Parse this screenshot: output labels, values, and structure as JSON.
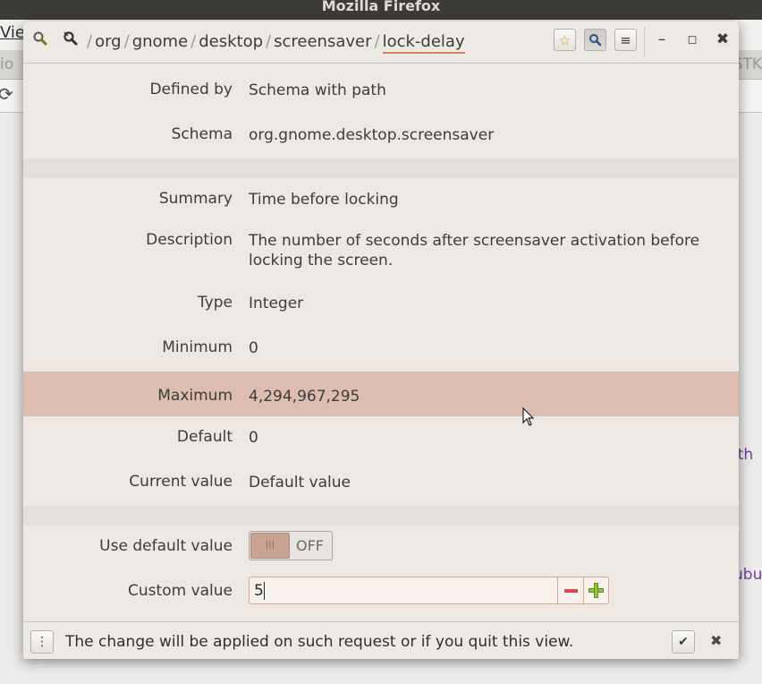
{
  "background_app": {
    "title": "Mozilla Firefox",
    "menu_view": "Vie",
    "tab_left": "io",
    "tab_right": "STK",
    "link_a": "ith",
    "link_b": "ubu"
  },
  "header": {
    "search_icon": "search-icon",
    "path_icon": "path-search-icon",
    "breadcrumbs": [
      "org",
      "gnome",
      "desktop",
      "screensaver",
      "lock-delay"
    ],
    "bookmark_icon": "star-icon",
    "search_toggle_icon": "magnifier-icon",
    "menu_icon": "hamburger-icon"
  },
  "properties": [
    {
      "label": "Defined by",
      "value": "Schema with path"
    },
    {
      "label": "Schema",
      "value": "org.gnome.desktop.screensaver"
    },
    {
      "label": "Summary",
      "value": "Time before locking"
    },
    {
      "label": "Description",
      "value": "The number of seconds after screensaver activation before locking the screen."
    },
    {
      "label": "Type",
      "value": "Integer"
    },
    {
      "label": "Minimum",
      "value": "0"
    },
    {
      "label": "Maximum",
      "value": "4,294,967,295"
    },
    {
      "label": "Default",
      "value": "0"
    },
    {
      "label": "Current value",
      "value": "Default value"
    }
  ],
  "settings": {
    "use_default_label": "Use default value",
    "use_default_state": "OFF",
    "custom_value_label": "Custom value",
    "custom_value": "5"
  },
  "footer": {
    "message": "The change will be applied on such request or if you quit this view."
  }
}
